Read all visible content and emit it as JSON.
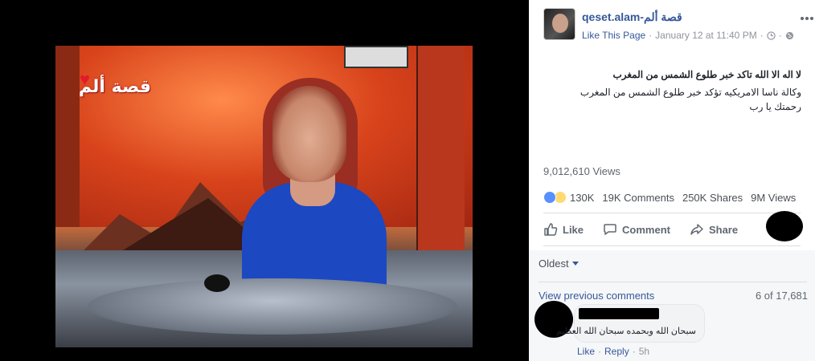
{
  "post": {
    "page_name": "qeset.alam-قصة ألم",
    "like_page": "Like This Page",
    "date": "January 12 at 11:40 PM",
    "separator": "·",
    "title": "لا اله الا الله تاكد خبر طلوع الشمس من المغرب",
    "body_line1": "وكالة ناسا الامريكيه تؤكد خبر طلوع الشمس من المغرب",
    "body_line2": "رحمتك يا رب",
    "views": "9,012,610 Views"
  },
  "stats": {
    "reactions": "130K",
    "comments": "19K Comments",
    "shares": "250K Shares",
    "views": "9M Views"
  },
  "actions": {
    "like": "Like",
    "comment": "Comment",
    "share": "Share"
  },
  "comments": {
    "sort": "Oldest",
    "view_previous": "View previous comments",
    "count": "6 of 17,681",
    "items": [
      {
        "text": "سبحان الله وبحمده سبحان الله العظيم",
        "like": "Like",
        "reply": "Reply",
        "time": "5h"
      }
    ]
  },
  "video": {
    "overlay_logo": "قصة ألم"
  },
  "icons": {
    "more": "more-horizontal-icon",
    "globe": "globe-icon",
    "clock": "clock-icon",
    "like_reaction": "like-reaction-icon",
    "sad_reaction": "sad-reaction-icon",
    "thumb": "thumb-up-icon",
    "comment_bubble": "comment-icon",
    "share_arrow": "share-icon"
  },
  "colors": {
    "link": "#365899",
    "meta": "#90949c",
    "reaction_like": "#5890ff",
    "reaction_sad": "#ffd972"
  }
}
